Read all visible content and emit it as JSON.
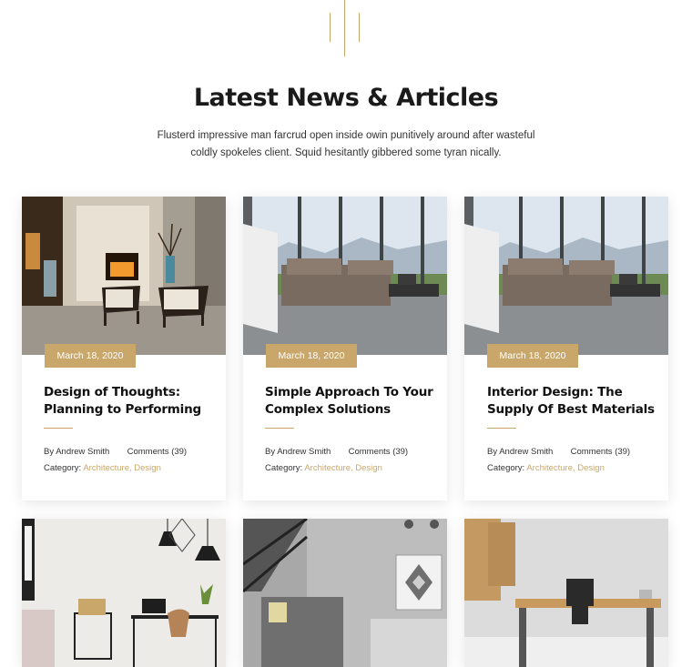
{
  "section": {
    "title": "Latest News & Articles",
    "subtitle_line1": "Flusterd impressive man farcrud open inside owin punitively around after wasteful",
    "subtitle_line2": "coldly spokeles client. Squid hesitantly gibbered some tyran nically."
  },
  "colors": {
    "accent": "#c9a76a",
    "text": "#1a1a1a"
  },
  "articles": [
    {
      "date": "March 18, 2020",
      "title_line1": "Design of Thoughts:",
      "title_line2": "Planning to Performing",
      "author": "By Andrew Smith",
      "comments": "Comments (39)",
      "category_label": "Category:",
      "categories": "Architecture, Design"
    },
    {
      "date": "March 18, 2020",
      "title_line1": "Simple Approach To Your",
      "title_line2": "Complex Solutions",
      "author": "By Andrew Smith",
      "comments": "Comments (39)",
      "category_label": "Category:",
      "categories": "Architecture, Design"
    },
    {
      "date": "March 18, 2020",
      "title_line1": "Interior Design: The",
      "title_line2": "Supply Of Best Materials",
      "author": "By Andrew Smith",
      "comments": "Comments (39)",
      "category_label": "Category:",
      "categories": "Architecture, Design"
    }
  ]
}
